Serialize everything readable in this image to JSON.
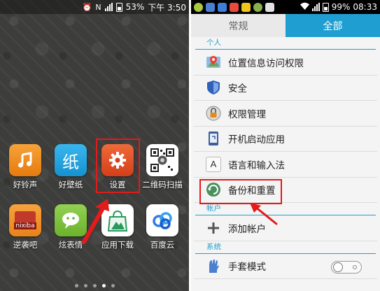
{
  "left_phone": {
    "status_bar": {
      "battery_percent": "53%",
      "time": "下午 3:50"
    },
    "apps_row1": [
      {
        "label": "好铃声",
        "icon": "music-note-icon",
        "color": "#f08a1a"
      },
      {
        "label": "好壁纸",
        "icon": "wallpaper-icon",
        "color": "#1aa3e0"
      },
      {
        "label": "设置",
        "icon": "gear-icon",
        "color": "#e05227"
      },
      {
        "label": "二维码扫描",
        "icon": "qr-code-icon",
        "color": "#ffffff"
      }
    ],
    "apps_row2": [
      {
        "label": "逆袭吧",
        "icon": "nixiba-icon",
        "color": "#f09426",
        "logo_text": "nixiba"
      },
      {
        "label": "炫表情",
        "icon": "speech-bubble-icon",
        "color": "#7cc242"
      },
      {
        "label": "应用下载",
        "icon": "app-store-bag-icon",
        "color": "#ffffff"
      },
      {
        "label": "百度云",
        "icon": "baidu-cloud-icon",
        "color": "#ffffff"
      }
    ],
    "page_indicator": {
      "count": 5,
      "current": 3
    },
    "annotation": {
      "highlighted_app": "设置",
      "color": "#e21b1b"
    }
  },
  "right_phone": {
    "status_bar": {
      "battery_percent": "99%",
      "time": "08:33"
    },
    "tabs": [
      {
        "label": "常规",
        "active": false
      },
      {
        "label": "全部",
        "active": true
      }
    ],
    "sections": [
      {
        "header": "个人",
        "items": [
          {
            "label": "位置信息访问权限",
            "icon": "location-icon"
          },
          {
            "label": "安全",
            "icon": "shield-icon"
          },
          {
            "label": "权限管理",
            "icon": "permission-lock-icon"
          },
          {
            "label": "开机启动应用",
            "icon": "startup-app-icon"
          },
          {
            "label": "语言和输入法",
            "icon": "language-a-icon"
          },
          {
            "label": "备份和重置",
            "icon": "backup-reset-icon",
            "highlighted": true
          }
        ]
      },
      {
        "header": "帐户",
        "items": [
          {
            "label": "添加帐户",
            "icon": "plus-icon"
          }
        ]
      },
      {
        "header": "系统",
        "items": [
          {
            "label": "手套模式",
            "icon": "glove-icon",
            "toggle": false
          }
        ]
      }
    ],
    "accent_color": "#1f9fd1"
  }
}
